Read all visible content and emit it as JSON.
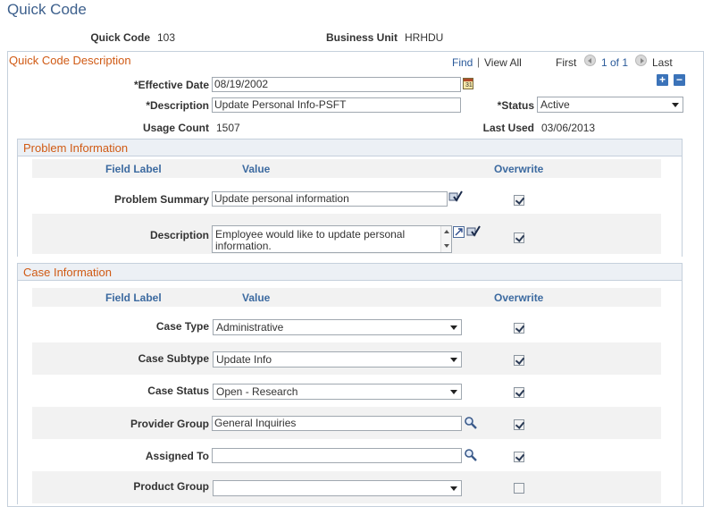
{
  "page": {
    "title": "Quick Code"
  },
  "header": {
    "quick_code_label": "Quick Code",
    "quick_code_value": "103",
    "business_unit_label": "Business Unit",
    "business_unit_value": "HRHDU"
  },
  "description_panel": {
    "title": "Quick Code Description",
    "find": "Find",
    "separator": "|",
    "view_all": "View All",
    "first": "First",
    "paging": "1 of 1",
    "last": "Last",
    "add": "+",
    "remove": "−",
    "effective_date_label": "*Effective Date",
    "effective_date_value": "08/19/2002",
    "description_label": "*Description",
    "description_value": "Update Personal Info-PSFT",
    "status_label": "*Status",
    "status_value": "Active",
    "usage_count_label": "Usage Count",
    "usage_count_value": "1507",
    "last_used_label": "Last Used",
    "last_used_value": "03/06/2013"
  },
  "problem_info": {
    "title": "Problem Information",
    "col_field_label": "Field Label",
    "col_value": "Value",
    "col_overwrite": "Overwrite",
    "rows": [
      {
        "label": "Problem Summary",
        "value": "Update personal information",
        "overwrite": true
      },
      {
        "label": "Description",
        "value": "Employee would like to update personal information.",
        "overwrite": true
      }
    ]
  },
  "case_info": {
    "title": "Case Information",
    "col_field_label": "Field Label",
    "col_value": "Value",
    "col_overwrite": "Overwrite",
    "rows": [
      {
        "label": "Case Type",
        "value": "Administrative",
        "control": "select",
        "overwrite": true
      },
      {
        "label": "Case Subtype",
        "value": "Update Info",
        "control": "select",
        "overwrite": true
      },
      {
        "label": "Case Status",
        "value": "Open - Research",
        "control": "select",
        "overwrite": true
      },
      {
        "label": "Provider Group",
        "value": "General Inquiries",
        "control": "lookup",
        "overwrite": true
      },
      {
        "label": "Assigned To",
        "value": "",
        "control": "lookup",
        "overwrite": true
      },
      {
        "label": "Product Group",
        "value": "",
        "control": "select",
        "overwrite": false
      }
    ]
  },
  "icons": {
    "calendar": "calendar-icon",
    "spellcheck": "spellcheck-icon",
    "expand": "expand-textarea-icon",
    "lookup": "lookup-magnifier-icon"
  },
  "colors": {
    "title": "#3c5f8c",
    "section_title": "#d05a14",
    "column_header": "#3c6aa0",
    "link": "#2a5a9a"
  }
}
